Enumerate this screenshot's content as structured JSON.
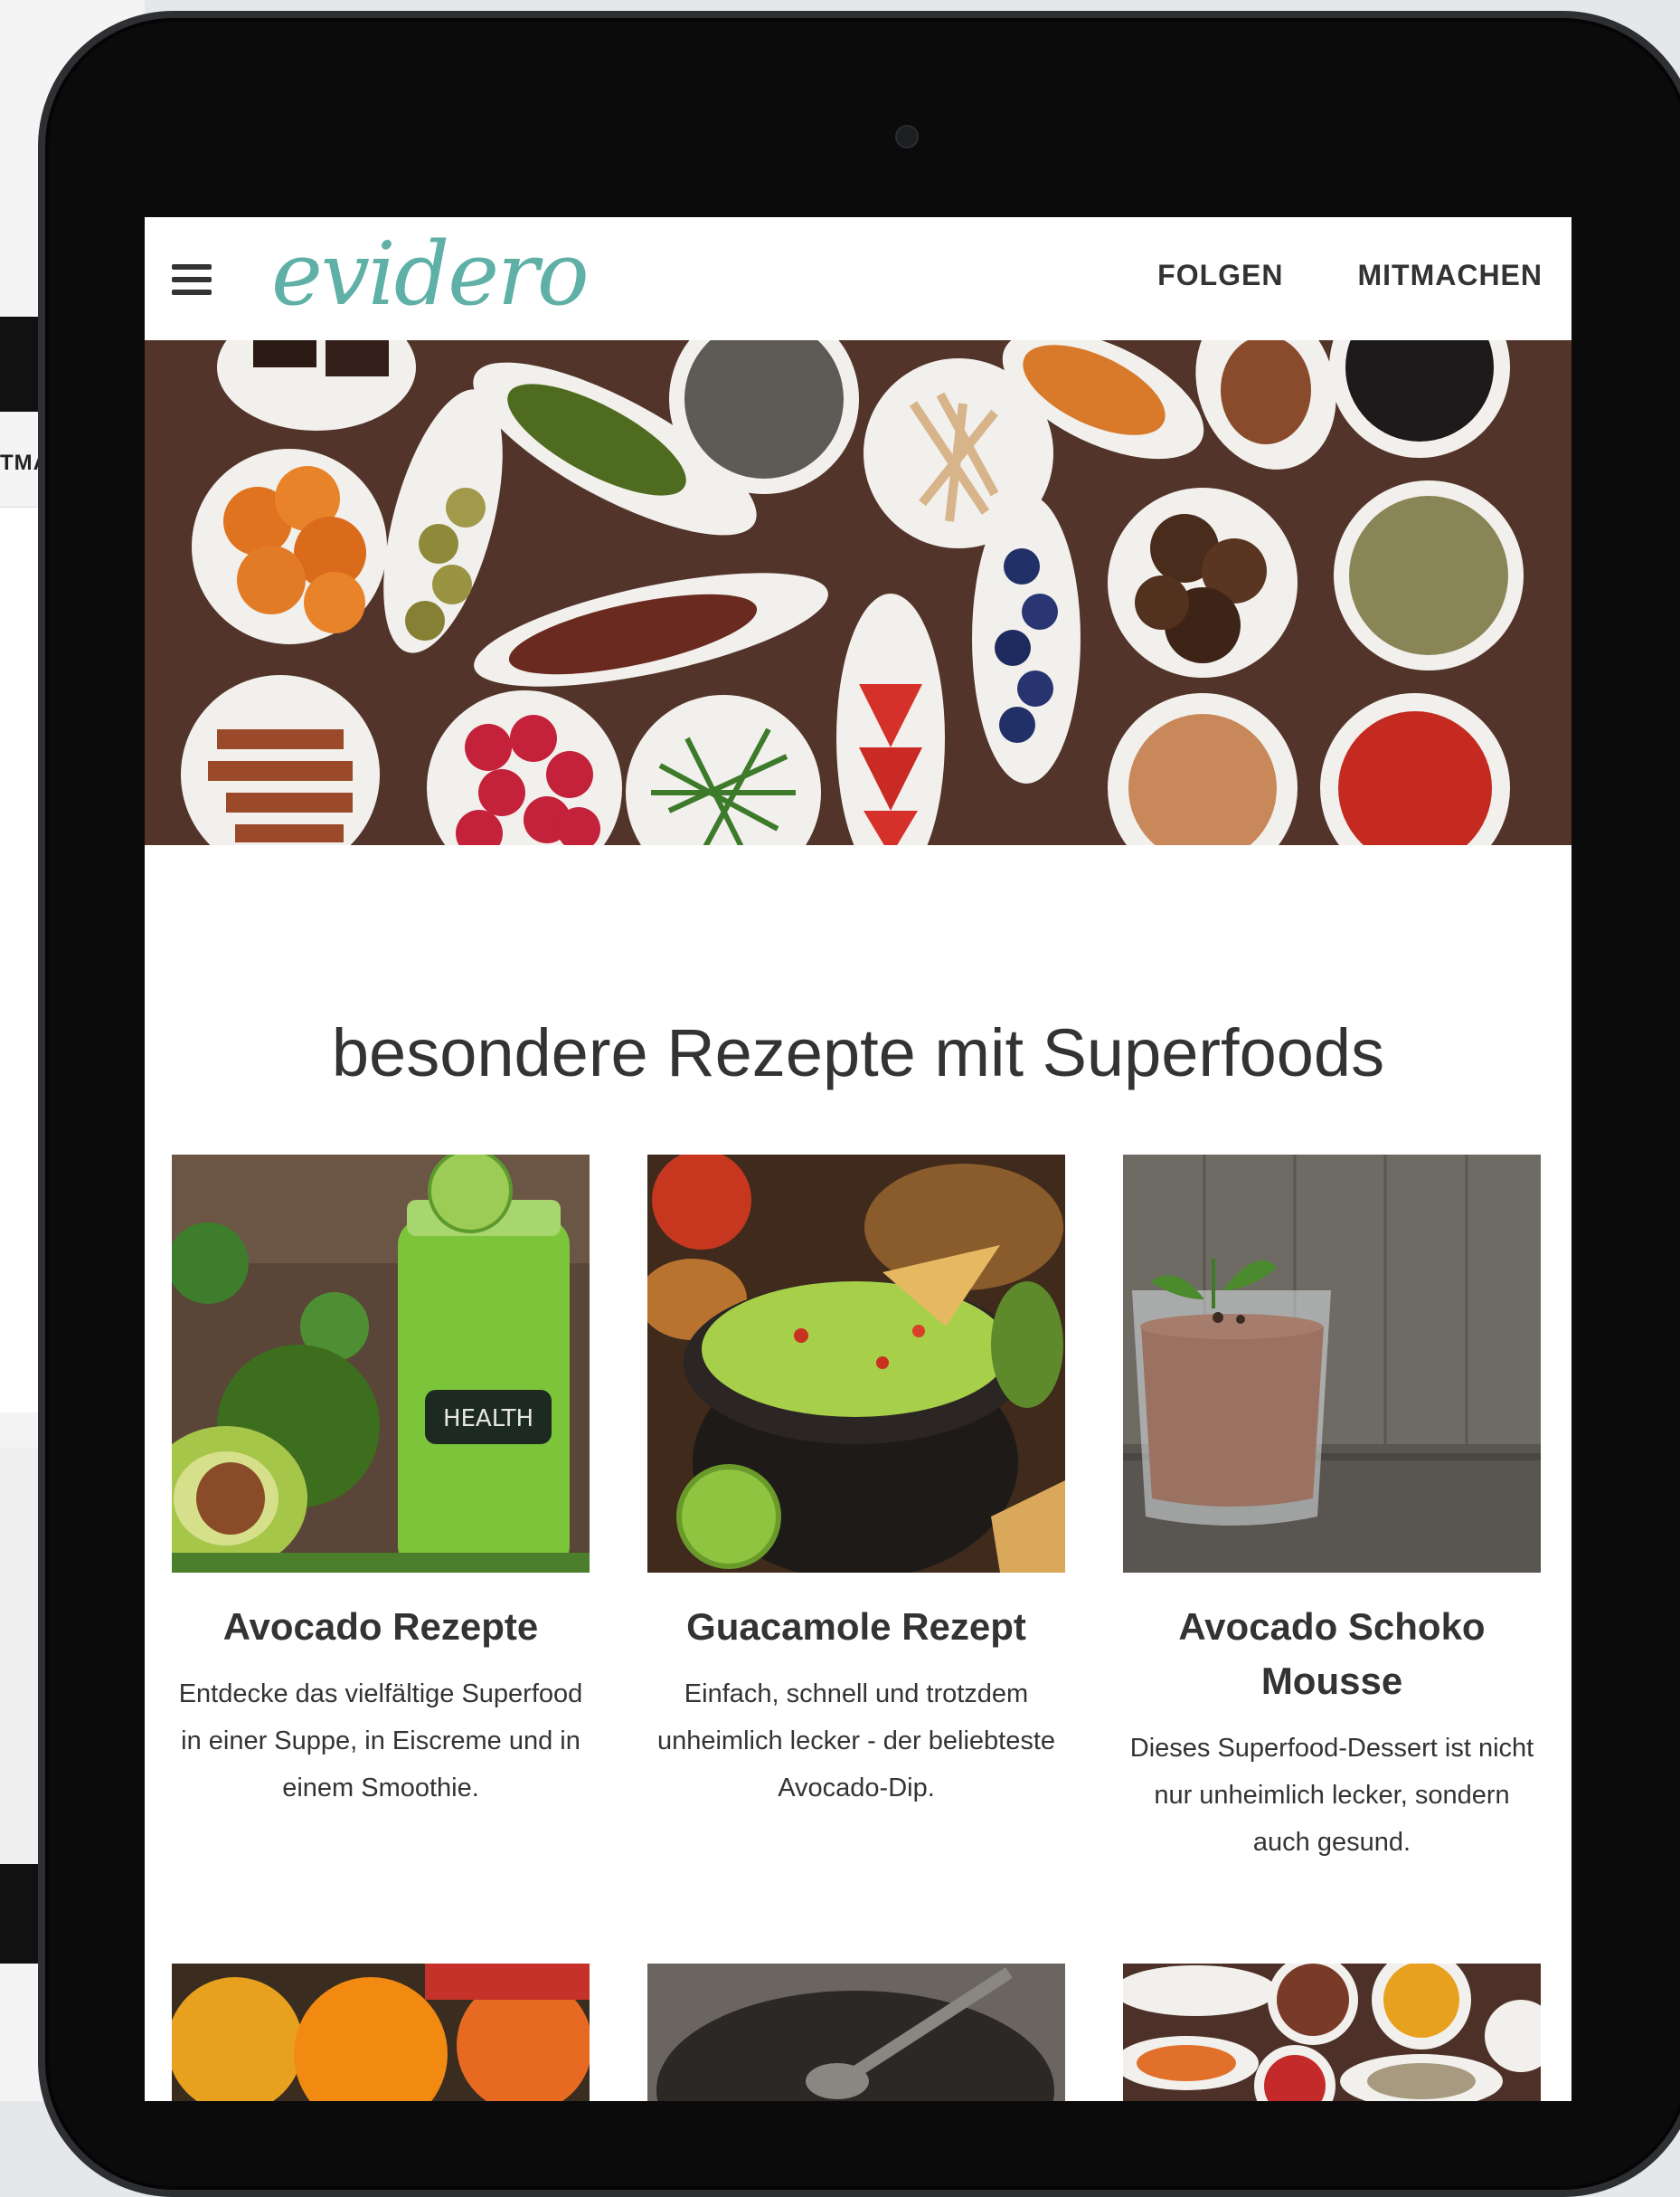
{
  "background": {
    "partial_nav_text": "TMA"
  },
  "site": {
    "logo": "evidero",
    "nav": [
      "FOLGEN",
      "MITMACHEN"
    ]
  },
  "section": {
    "title": "besondere Rezepte mit Superfoods"
  },
  "cards": [
    {
      "title": "Avocado Rezepte",
      "text": "Entdecke das vielfältige Superfood in einer Suppe, in Eiscreme und in einem Smoothie.",
      "jar_label": "HEALTH"
    },
    {
      "title": "Guacamole Rezept",
      "text": "Einfach, schnell und trotzdem unheimlich lecker - der beliebteste Avocado-Dip."
    },
    {
      "title": "Avocado Schoko Mousse",
      "text": "Dieses Superfood-Dessert ist nicht nur unheimlich lecker, sondern auch gesund."
    }
  ],
  "colors": {
    "brand": "#5fb0a7",
    "tablet_frame": "#0b0b0c",
    "text": "#333333"
  }
}
